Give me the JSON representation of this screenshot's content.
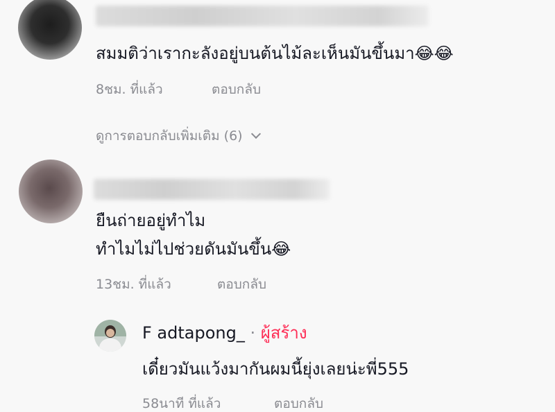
{
  "comment1": {
    "text": "สมมติว่าเรากะลังอยู่บนต้นไม้ละเห็นมันขึ้นมา😂😂",
    "time": "8ชม. ที่แล้ว",
    "reply_label": "ตอบกลับ",
    "view_more": "ดูการตอบกลับเพิ่มเติม (6)"
  },
  "comment2": {
    "line1": "ยืนถ่ายอยู่ทำไม",
    "line2": "ทำไมไม่ไปช่วยดันมันขึ้น😂",
    "time": "13ชม. ที่แล้ว",
    "reply_label": "ตอบกลับ"
  },
  "reply1": {
    "username": "F adtapong_",
    "separator": "·",
    "creator_badge": "ผู้สร้าง",
    "text": "เดี๋ยวมันแว้งมากันผมนี้ยุ่งเลยน่ะพี่555",
    "time": "58นาที ที่แล้ว",
    "reply_label": "ตอบกลับ"
  },
  "icons": {
    "expand": "chevron-down-icon"
  },
  "colors": {
    "creator": "#fe2c55",
    "meta": "#8a8b91",
    "text": "#161823"
  }
}
